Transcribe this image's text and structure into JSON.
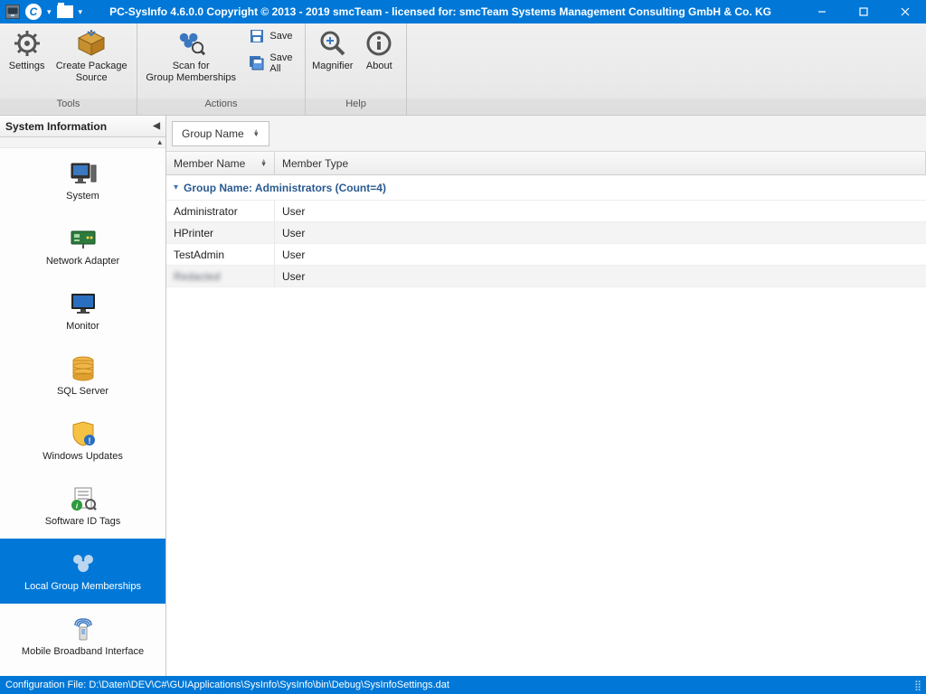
{
  "window": {
    "title": "PC-SysInfo 4.6.0.0 Copyright © 2013 - 2019 smcTeam - licensed for: smcTeam Systems Management Consulting GmbH & Co. KG",
    "app_badge": "C"
  },
  "ribbon": {
    "groups": {
      "tools": {
        "label": "Tools",
        "settings": "Settings",
        "create_package": "Create Package Source"
      },
      "actions": {
        "label": "Actions",
        "scan": "Scan for\nGroup Memberships",
        "save": "Save",
        "save_all": "Save All"
      },
      "help": {
        "label": "Help",
        "magnifier": "Magnifier",
        "about": "About"
      }
    }
  },
  "sidebar": {
    "header": "System Information",
    "items": [
      {
        "label": "System"
      },
      {
        "label": "Network Adapter"
      },
      {
        "label": "Monitor"
      },
      {
        "label": "SQL Server"
      },
      {
        "label": "Windows Updates"
      },
      {
        "label": "Software ID Tags"
      },
      {
        "label": "Local Group Memberships"
      },
      {
        "label": "Mobile Broadband Interface"
      }
    ],
    "selected_index": 6
  },
  "grid": {
    "group_by_chip": "Group Name",
    "columns": {
      "member_name": "Member Name",
      "member_type": "Member Type"
    },
    "group_header": "Group Name: Administrators (Count=4)",
    "rows": [
      {
        "member_name": "Administrator",
        "member_type": "User"
      },
      {
        "member_name": "HPrinter",
        "member_type": "User"
      },
      {
        "member_name": "TestAdmin",
        "member_type": "User"
      },
      {
        "member_name": "Redacted",
        "member_type": "User",
        "blurred": true
      }
    ]
  },
  "statusbar": {
    "text": "Configuration File: D:\\Daten\\DEV\\C#\\GUIApplications\\SysInfo\\SysInfo\\bin\\Debug\\SysInfoSettings.dat"
  }
}
